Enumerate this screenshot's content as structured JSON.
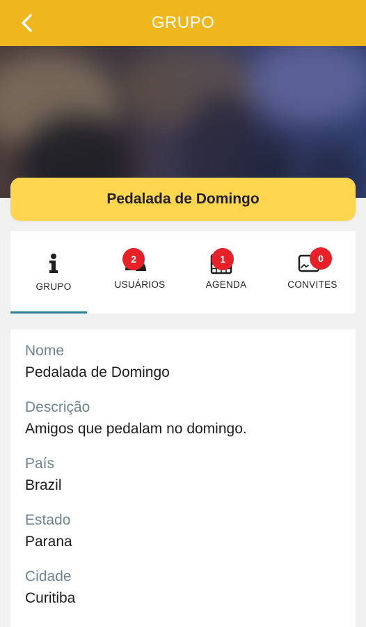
{
  "app_bar": {
    "title": "GRUPO",
    "back_icon": "chevron-left-icon"
  },
  "group": {
    "name": "Pedalada de Domingo"
  },
  "tabs": [
    {
      "label": "GRUPO",
      "icon": "info-icon",
      "badge": null,
      "active": true
    },
    {
      "label": "USUÁRIOS",
      "icon": "users-icon",
      "badge": "2",
      "active": false
    },
    {
      "label": "AGENDA",
      "icon": "calendar-icon",
      "badge": "1",
      "active": false
    },
    {
      "label": "CONVITES",
      "icon": "invite-card-icon",
      "badge": "0",
      "active": false
    }
  ],
  "details": {
    "fields": [
      {
        "label": "Nome",
        "value": "Pedalada de Domingo"
      },
      {
        "label": "Descrição",
        "value": "Amigos que pedalam no domingo."
      },
      {
        "label": "País",
        "value": "Brazil"
      },
      {
        "label": "Estado",
        "value": "Parana"
      },
      {
        "label": "Cidade",
        "value": "Curitiba"
      }
    ]
  },
  "colors": {
    "app_bar": "#efb71d",
    "banner": "#fdd54e",
    "badge": "#e62128",
    "tab_indicator": "#2b7f92",
    "field_label": "#6d8592"
  }
}
